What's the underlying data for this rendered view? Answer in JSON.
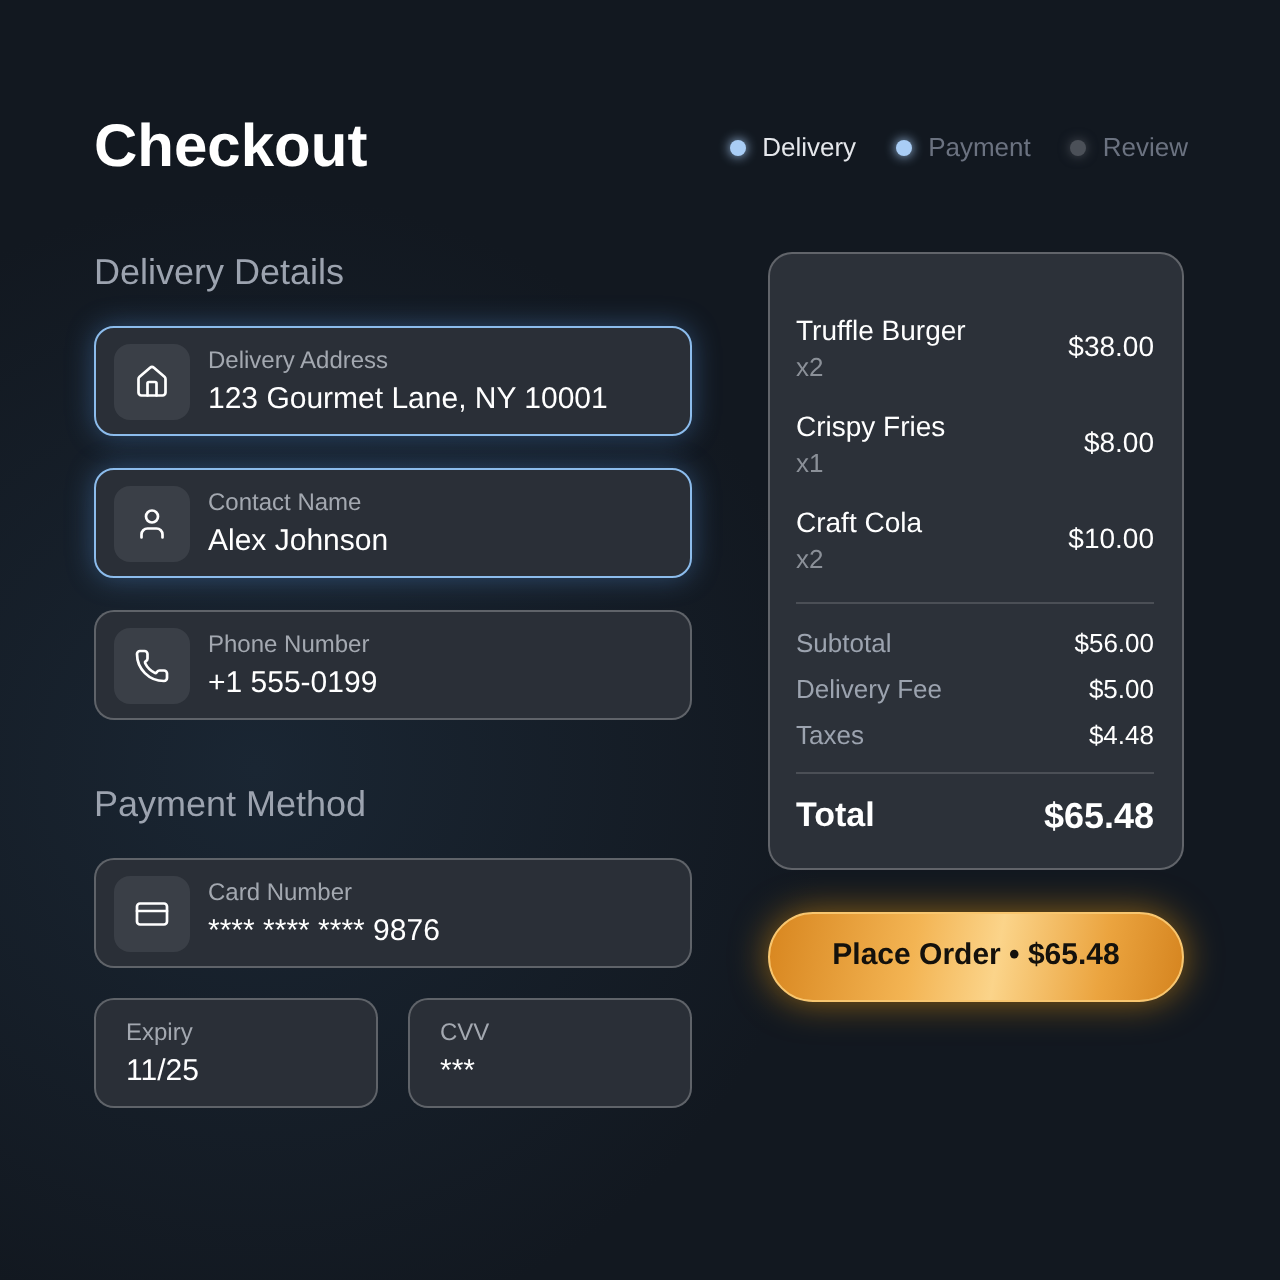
{
  "header": {
    "title": "Checkout",
    "steps": [
      {
        "label": "Delivery",
        "selected": true,
        "color": "#a9cdf5"
      },
      {
        "label": "Payment",
        "selected": false,
        "color": "#a9cdf5"
      },
      {
        "label": "Review",
        "selected": false,
        "color": "#4b5058"
      }
    ]
  },
  "delivery_details": {
    "heading": "Delivery Details",
    "fields": [
      {
        "label": "Delivery Address",
        "value": "123 Gourmet Lane, NY 10001",
        "highlighted": true
      },
      {
        "label": "Contact Name",
        "value": "Alex Johnson",
        "highlighted": true
      },
      {
        "label": "Phone Number",
        "value": "+1 555-0199",
        "highlighted": false
      }
    ]
  },
  "payment_method": {
    "heading": "Payment Method",
    "card": {
      "label": "Card Number",
      "value": "**** **** **** 9876",
      "highlighted": false
    },
    "expiry": {
      "label": "Expiry",
      "value": "11/25",
      "highlighted": false
    },
    "cvv": {
      "label": "CVV",
      "value": "***",
      "highlighted": false
    }
  },
  "order_summary": {
    "items": [
      {
        "name": "Truffle Burger",
        "quantity": "x2",
        "price": "$38.00"
      },
      {
        "name": "Crispy Fries",
        "quantity": "x1",
        "price": "$8.00"
      },
      {
        "name": "Craft Cola",
        "quantity": "x2",
        "price": "$10.00"
      }
    ],
    "totals": [
      {
        "label": "Subtotal",
        "value": "$56.00"
      },
      {
        "label": "Delivery Fee",
        "value": "$5.00"
      },
      {
        "label": "Taxes",
        "value": "$4.48"
      }
    ],
    "total": {
      "label": "Total",
      "value": "$65.48"
    }
  },
  "place_order_button": {
    "label": "Place Order • $65.48"
  }
}
